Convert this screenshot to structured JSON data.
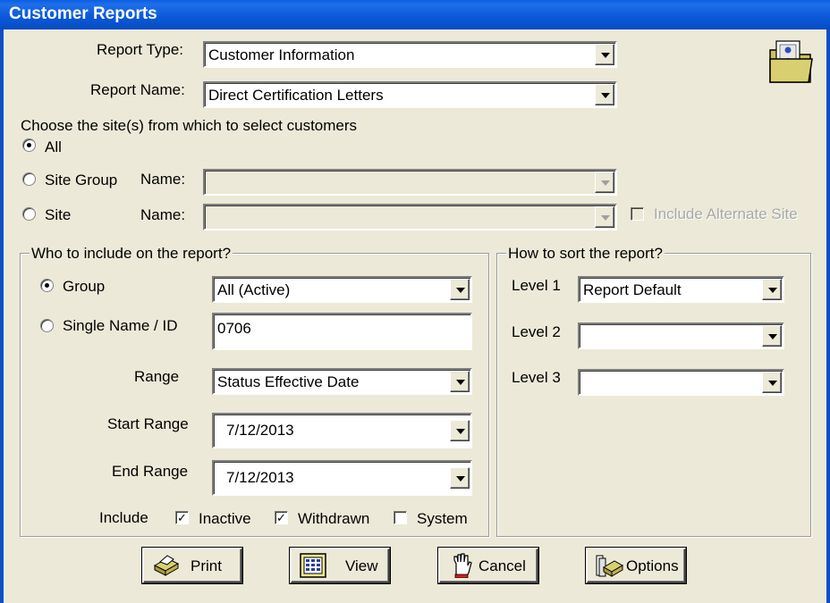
{
  "window": {
    "title": "Customer Reports"
  },
  "report": {
    "type_label": "Report Type:",
    "type_value": "Customer Information",
    "name_label": "Report Name:",
    "name_value": "Direct Certification Letters"
  },
  "sites": {
    "heading": "Choose the site(s) from which to select customers",
    "all_label": "All",
    "site_group_label": "Site Group",
    "site_group_name_label": "Name:",
    "site_label": "Site",
    "site_name_label": "Name:",
    "include_alternate_label": "Include Alternate Site"
  },
  "who": {
    "title": "Who to include on the report?",
    "group_label": "Group",
    "group_value": "All (Active)",
    "single_label": "Single Name / ID",
    "single_value": "0706",
    "range_label": "Range",
    "range_value": "Status Effective Date",
    "start_label": "Start Range",
    "start_value": "7/12/2013",
    "end_label": "End Range",
    "end_value": "7/12/2013",
    "include_label": "Include",
    "inactive_label": "Inactive",
    "withdrawn_label": "Withdrawn",
    "system_label": "System",
    "inactive_checked": true,
    "withdrawn_checked": true,
    "system_checked": false
  },
  "sort": {
    "title": "How to sort the report?",
    "level1_label": "Level 1",
    "level1_value": "Report Default",
    "level2_label": "Level 2",
    "level2_value": "",
    "level3_label": "Level 3",
    "level3_value": ""
  },
  "buttons": {
    "print": "Print",
    "view": "View",
    "cancel": "Cancel",
    "options": "Options"
  },
  "icons": {
    "folder": "folder-people-icon",
    "print": "printer-icon",
    "view": "calculator-screen-icon",
    "cancel": "hand-stop-icon",
    "options": "options-book-icon"
  },
  "colors": {
    "titlebar": "#0A58D8",
    "dialog_bg": "#ECE9D8",
    "disabled_text": "#A8A8A8"
  }
}
